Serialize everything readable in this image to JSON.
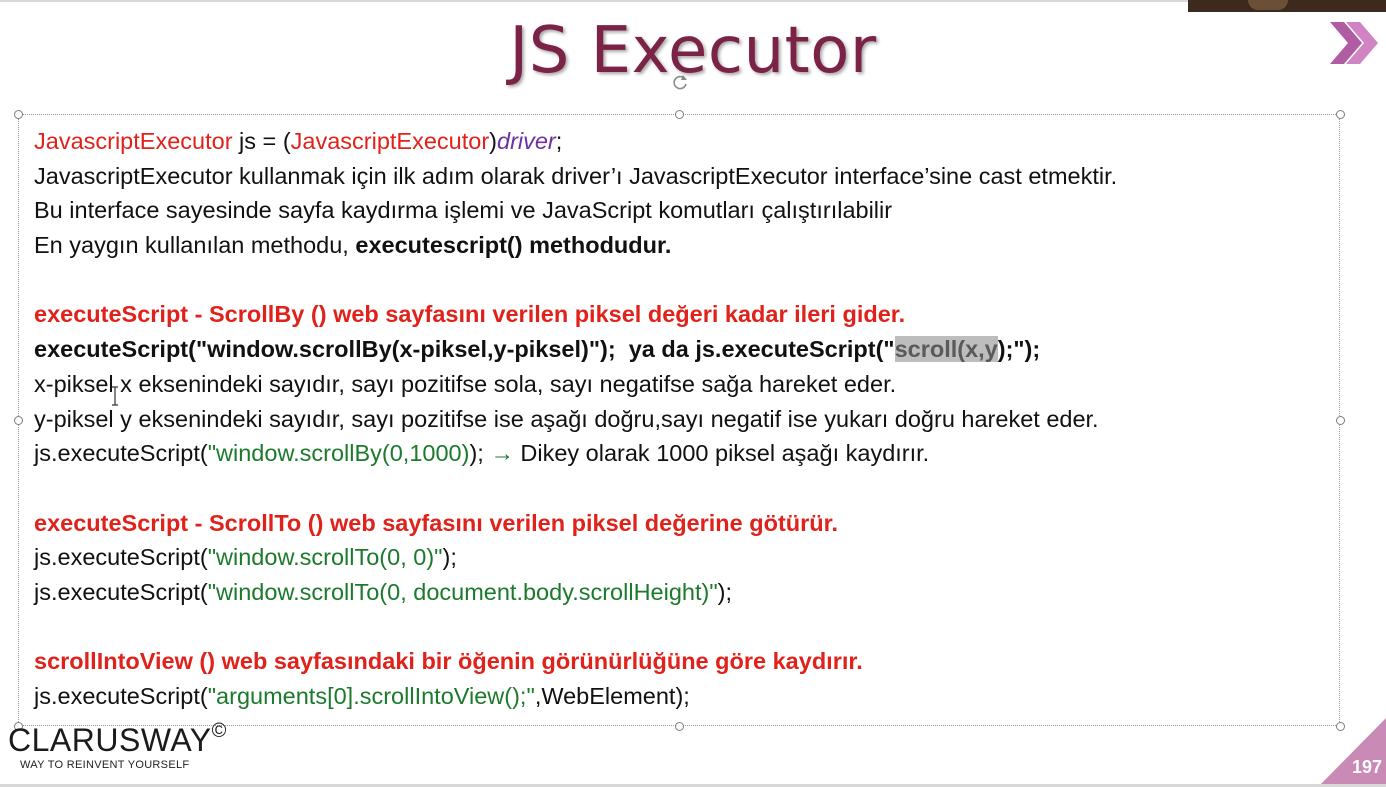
{
  "slide": {
    "title": "JS Executor",
    "page_number": "197"
  },
  "logo": {
    "name": "CLARUSWAY",
    "symbol": "©",
    "tagline": "WAY TO REINVENT YOURSELF"
  },
  "lines": {
    "l1_a": "JavascriptExecutor",
    "l1_b": " js = (",
    "l1_c": "JavascriptExecutor",
    "l1_d": ")",
    "l1_e": "driver",
    "l1_f": ";",
    "l2": "JavascriptExecutor kullanmak için ilk adım olarak driver’ı JavascriptExecutor interface’sine cast etmektir.",
    "l3": "Bu interface sayesinde sayfa kaydırma işlemi ve JavaScript komutları çalıştırılabilir",
    "l4_a": "En yaygın kullanılan methodu, ",
    "l4_b": "executescript() methodudur.",
    "h1": "executeScript - ScrollBy () web sayfasını verilen piksel değeri kadar ileri gider.",
    "l6_a": "executeScript(\"window.scrollBy(x-piksel,y-piksel)\");  ya da js.executeScript(\"",
    "l6_b": "scroll(x,y",
    "l6_c": ");\");",
    "l7": "x-piksel x eksenindeki sayıdır, sayı pozitifse sola, sayı negatifse sağa hareket eder.",
    "l8": "y-piksel y eksenindeki sayıdır, sayı pozitifse ise aşağı doğru,sayı negatif ise yukarı doğru hareket eder.",
    "l9_a": "js.executeScript(",
    "l9_b": "\"window.scrollBy(0,1000)",
    "l9_c": "); ",
    "l9_arrow": "→",
    "l9_d": " Dikey olarak 1000 piksel aşağı kaydırır.",
    "h2": "executeScript - ScrollTo () web sayfasını verilen piksel değerine götürür.",
    "l11_a": "js.executeScript(",
    "l11_b": "\"window.scrollTo(0, 0)\"",
    "l11_c": ");",
    "l12_a": "js.executeScript(",
    "l12_b": "\"window.scrollTo(0, document.body.scrollHeight)\"",
    "l12_c": ");",
    "h3": "scrollIntoView () web sayfasındaki bir öğenin görünürlüğüne göre kaydırır.",
    "l14_a": "js.executeScript(",
    "l14_b": "\"arguments[0].scrollIntoView();\"",
    "l14_c": ",WebElement);"
  },
  "colors": {
    "title": "#7a2346",
    "red": "#e0221b",
    "green": "#1b7a2c",
    "purple": "#7030a0",
    "accent_corner": "#c98bb6"
  },
  "icons": [
    "chevrons-icon",
    "rotate-handle-icon",
    "text-cursor-icon"
  ]
}
